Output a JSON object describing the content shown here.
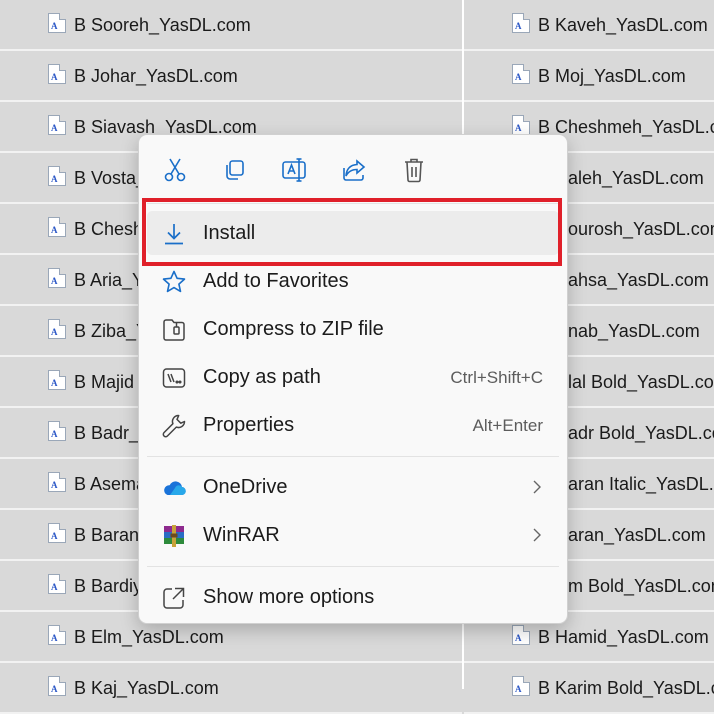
{
  "files_left": [
    "B Sooreh_YasDL.com",
    "B Johar_YasDL.com",
    "B Siavash_YasDL.com",
    "B Vosta_",
    "B Chesh",
    "B Aria_Ya",
    "B Ziba_Y",
    "B Majid",
    "B Badr_Y",
    "B Asema",
    "B Baran",
    "B Bardiy",
    "B Elm_YasDL.com",
    "B Kaj_YasDL.com"
  ],
  "files_right": [
    "B Kaveh_YasDL.com",
    "B Moj_YasDL.com",
    "B Cheshmeh_YasDL.com",
    "aleh_YasDL.com",
    "ourosh_YasDL.com",
    "ahsa_YasDL.com",
    "nab_YasDL.com",
    "lal Bold_YasDL.com",
    "adr Bold_YasDL.com",
    "aran Italic_YasDL.com",
    "aran_YasDL.com",
    "m Bold_YasDL.com",
    "B Hamid_YasDL.com",
    "B Karim Bold_YasDL.com"
  ],
  "file_icon_glyph": "A",
  "toolbar": [
    {
      "name": "cut-icon"
    },
    {
      "name": "copy-icon"
    },
    {
      "name": "rename-icon"
    },
    {
      "name": "share-icon"
    },
    {
      "name": "delete-icon"
    }
  ],
  "menu": {
    "install": {
      "label": "Install",
      "icon": "download-icon"
    },
    "favorites": {
      "label": "Add to Favorites",
      "icon": "star-icon"
    },
    "compress": {
      "label": "Compress to ZIP file",
      "icon": "zip-icon"
    },
    "copy_path": {
      "label": "Copy as path",
      "shortcut": "Ctrl+Shift+C",
      "icon": "path-icon"
    },
    "properties": {
      "label": "Properties",
      "shortcut": "Alt+Enter",
      "icon": "wrench-icon"
    },
    "onedrive": {
      "label": "OneDrive",
      "icon": "cloud-icon"
    },
    "winrar": {
      "label": "WinRAR",
      "icon": "winrar-icon"
    },
    "more": {
      "label": "Show more options",
      "icon": "more-options-icon"
    }
  },
  "colors": {
    "highlight_border": "#e0202a",
    "accent": "#1a6fc9"
  }
}
